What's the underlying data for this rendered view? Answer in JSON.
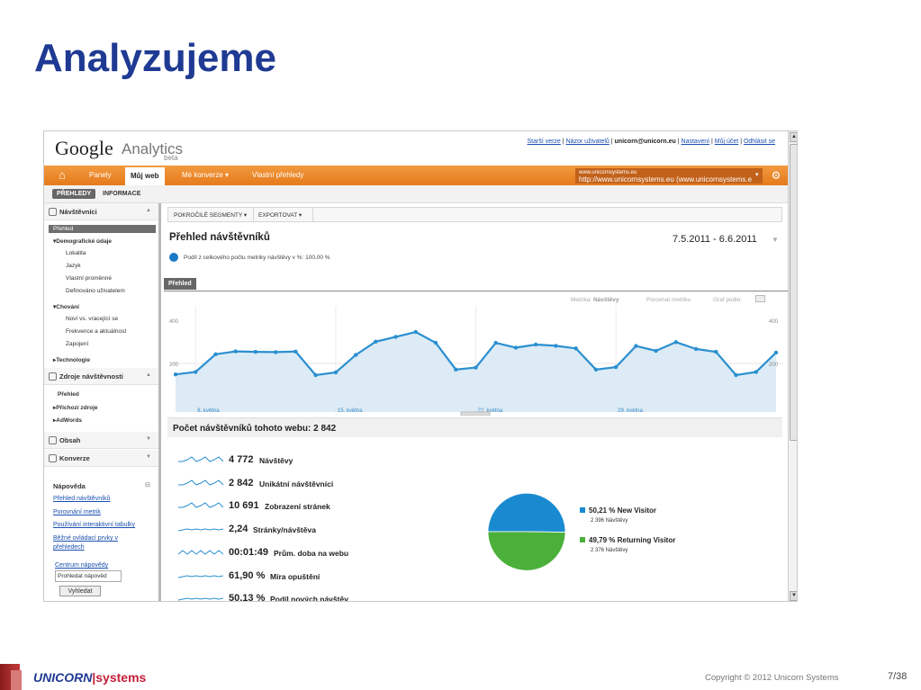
{
  "slide": {
    "title": "Analyzujeme",
    "footer_brand_a": "UNICORN",
    "footer_brand_b": "systems",
    "copyright": "Copyright © 2012 Unicorn Systems",
    "page": "7/38"
  },
  "ga": {
    "logo": "Google",
    "product": "Analytics",
    "beta": "beta",
    "toplinks": {
      "older": "Starší verze",
      "feedback": "Názor uživatelů",
      "email": "unicorn@unicorn.eu",
      "settings": "Nastavení",
      "account": "Můj účet",
      "logout": "Odhlásit se"
    },
    "nav": {
      "home": "⌂",
      "dashboards": "Panely",
      "myweb": "Můj web",
      "conversions": "Mé konverze ▾",
      "custom": "Vlastní přehledy",
      "site_small": "www.unicornsystems.eu",
      "site_url": "http://www.unicornsystems.eu (www.unicornsystems.e",
      "site_arrow": "▾",
      "gear": "⚙"
    },
    "subtabs": {
      "reports": "PŘEHLEDY",
      "info": "INFORMACE"
    }
  },
  "sidebar": {
    "visitors": "Návštěvníci",
    "overview": "Přehled",
    "demographics": "▾Demografické údaje",
    "location": "Lokalita",
    "language": "Jazyk",
    "custom_vars": "Vlastní proměnné",
    "user_defined": "Definováno uživatelem",
    "behavior": "▾Chování",
    "new_returning": "Noví vs. vracející se",
    "frequency": "Frekvence a aktuálnost",
    "engagement": "Zapojení",
    "technology": "▸Technologie",
    "traffic": "Zdroje návštěvnosti",
    "traffic_overview": "Přehled",
    "incoming": "▸Příchozí zdroje",
    "adwords": "▸AdWords",
    "content": "Obsah",
    "conversions": "Konverze",
    "help_title": "Nápověda",
    "help_links": [
      "Přehled návštěvníků",
      "Porovnání metrik",
      "Používání interaktivní tabulky",
      "Běžné ovládací prvky v",
      "přehledech"
    ],
    "help_center": "Centrum nápovědy",
    "search_value": "Prohledat nápověd",
    "search_button": "Vyhledat"
  },
  "report": {
    "advanced_segments": "POKROČILÉ SEGMENTY ▾",
    "export": "EXPORTOVAT ▾",
    "title": "Přehled návštěvníků",
    "date": "7.5.2011 - 6.6.2011",
    "percent_note": "Podíl z celkového počtu metriky návštěvy v %: 100,00 %",
    "tab": "Přehled",
    "metric_label": "Metrika:",
    "metric_value": "Návštěvy",
    "compare": "Porovnat metriku",
    "graph_by": "Graf podle:",
    "visits_header": "Počet návštěvníků tohoto webu: 2 842",
    "metrics": [
      {
        "value": "4 772",
        "label": "Návštěvy"
      },
      {
        "value": "2 842",
        "label": "Unikátní návštěvníci"
      },
      {
        "value": "10 691",
        "label": "Zobrazení stránek"
      },
      {
        "value": "2,24",
        "label": "Stránky/návštěva"
      },
      {
        "value": "00:01:49",
        "label": "Prům. doba na webu"
      },
      {
        "value": "61,90 %",
        "label": "Míra opuštění"
      },
      {
        "value": "50,13 %",
        "label": "Podíl nových návštěv"
      }
    ],
    "pie": [
      {
        "pct": "50,21 %",
        "name": "New Visitor",
        "sub": "2 396 Návštěvy",
        "value": 50.21,
        "color": "#1a8ad0"
      },
      {
        "pct": "49,79 %",
        "name": "Returning Visitor",
        "sub": "2 376 Návštěvy",
        "value": 49.79,
        "color": "#4bb03a"
      }
    ]
  },
  "chart_data": {
    "type": "area",
    "x_tick_labels": [
      "8. května",
      "15. května",
      "22. května",
      "29. května"
    ],
    "y_tick_labels": [
      "400",
      "200"
    ],
    "ylim": [
      0,
      400
    ],
    "series": [
      {
        "values": [
          155,
          165,
          238,
          250,
          248,
          247,
          249,
          152,
          163,
          235,
          290,
          310,
          330,
          285,
          175,
          183,
          285,
          265,
          278,
          273,
          262,
          175,
          185,
          272,
          252,
          288,
          260,
          248,
          152,
          165,
          245
        ]
      }
    ],
    "color": "#2a8fd0",
    "fill": "#dcebf5"
  }
}
